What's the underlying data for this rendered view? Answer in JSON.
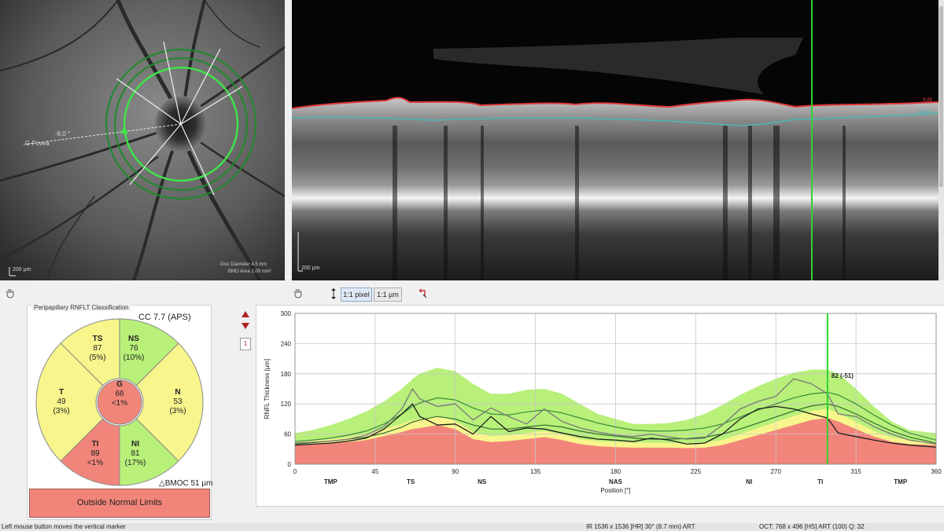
{
  "fundus": {
    "angle_label": "-8.0 °",
    "fovea_label": "G Fovea",
    "scale_label": "200 µm",
    "info_line1": "Disc Diameter 4.5 mm",
    "info_line2": "BMO Area 1.09 mm²"
  },
  "bscan": {
    "ilm_label": "ILM",
    "rnfl_label": "RNFL",
    "scale_label": "200 µm"
  },
  "toolbar": {
    "pixel_label": "1:1 pixel",
    "um_label": "1:1 µm"
  },
  "classification": {
    "title": "Peripapillary RNFLT Classification",
    "cc_label": "CC 7.7 (APS)",
    "bmo_label": "△BMOC 51 µm",
    "verdict": "Outside Normal Limits",
    "colors": {
      "normal": "#b8f07a",
      "borderline": "#f8f58c",
      "outside": "#f2857a"
    },
    "sectors": {
      "TS": {
        "name": "TS",
        "value": "87",
        "pct": "(5%)"
      },
      "NS": {
        "name": "NS",
        "value": "76",
        "pct": "(10%)"
      },
      "T": {
        "name": "T",
        "value": "49",
        "pct": "(3%)"
      },
      "N": {
        "name": "N",
        "value": "53",
        "pct": "(3%)"
      },
      "TI": {
        "name": "TI",
        "value": "89",
        "pct": "<1%"
      },
      "NI": {
        "name": "NI",
        "value": "81",
        "pct": "(17%)"
      },
      "G": {
        "name": "G",
        "value": "66",
        "pct": "<1%"
      }
    }
  },
  "side_controls": {
    "page_number": "1"
  },
  "chart_data": {
    "type": "line",
    "ylabel": "RNFL Thickness [µm]",
    "xlabel": "Position [°]",
    "xlim": [
      0,
      360
    ],
    "ylim": [
      0,
      300
    ],
    "x_ticks": [
      0,
      45,
      90,
      135,
      180,
      225,
      270,
      315,
      360
    ],
    "y_ticks": [
      0,
      60,
      120,
      180,
      240,
      300
    ],
    "sector_labels": [
      {
        "x": 20,
        "label": "TMP"
      },
      {
        "x": 65,
        "label": "TS"
      },
      {
        "x": 105,
        "label": "NS"
      },
      {
        "x": 180,
        "label": "NAS"
      },
      {
        "x": 255,
        "label": "NI"
      },
      {
        "x": 295,
        "label": "TI"
      },
      {
        "x": 340,
        "label": "TMP"
      }
    ],
    "marker_x": 299,
    "marker_label": "82 (-51)",
    "x": [
      0,
      10,
      20,
      30,
      40,
      50,
      60,
      66,
      70,
      80,
      90,
      100,
      110,
      120,
      130,
      140,
      150,
      160,
      170,
      180,
      190,
      200,
      210,
      220,
      230,
      240,
      250,
      260,
      270,
      280,
      290,
      299,
      305,
      315,
      325,
      335,
      345,
      360
    ],
    "bands": {
      "outside_upper": [
        38,
        40,
        42,
        44,
        48,
        56,
        64,
        70,
        72,
        78,
        70,
        50,
        44,
        46,
        50,
        54,
        48,
        40,
        36,
        34,
        33,
        33,
        33,
        32,
        33,
        38,
        48,
        58,
        68,
        78,
        88,
        92,
        85,
        70,
        55,
        45,
        40,
        38
      ],
      "borderline_upper": [
        45,
        47,
        50,
        54,
        60,
        70,
        80,
        88,
        90,
        96,
        86,
        64,
        56,
        58,
        62,
        66,
        60,
        50,
        46,
        44,
        43,
        43,
        42,
        42,
        43,
        48,
        60,
        72,
        84,
        96,
        106,
        110,
        102,
        84,
        66,
        54,
        48,
        45
      ],
      "normal_upper": [
        62,
        68,
        78,
        90,
        105,
        125,
        150,
        170,
        180,
        192,
        185,
        160,
        140,
        140,
        148,
        150,
        140,
        120,
        100,
        90,
        80,
        80,
        82,
        88,
        100,
        118,
        138,
        155,
        170,
        182,
        188,
        188,
        180,
        150,
        115,
        85,
        68,
        62
      ]
    },
    "series": [
      {
        "name": "",
        "color": "#3c8a3c",
        "values": [
          45,
          48,
          52,
          58,
          66,
          80,
          100,
          115,
          122,
          132,
          128,
          112,
          100,
          98,
          104,
          108,
          102,
          92,
          82,
          74,
          68,
          66,
          66,
          68,
          72,
          80,
          94,
          108,
          120,
          132,
          140,
          143,
          138,
          120,
          98,
          78,
          62,
          48
        ]
      },
      {
        "name": "",
        "color": "#2e6e2e",
        "values": [
          40,
          43,
          46,
          50,
          54,
          62,
          74,
          84,
          88,
          95,
          90,
          78,
          70,
          70,
          74,
          78,
          74,
          66,
          60,
          56,
          52,
          50,
          50,
          51,
          54,
          60,
          70,
          82,
          94,
          106,
          116,
          120,
          115,
          100,
          82,
          66,
          54,
          42
        ]
      },
      {
        "name": "",
        "color": "#777777",
        "values": [
          42,
          44,
          46,
          50,
          58,
          75,
          110,
          150,
          130,
          115,
          120,
          88,
          112,
          95,
          80,
          110,
          85,
          72,
          64,
          58,
          55,
          60,
          54,
          50,
          52,
          78,
          110,
          125,
          135,
          170,
          160,
          140,
          100,
          95,
          75,
          60,
          48,
          40
        ]
      },
      {
        "name": "",
        "color": "#1e1e1e",
        "values": [
          38,
          40,
          42,
          46,
          52,
          70,
          100,
          120,
          95,
          78,
          80,
          60,
          95,
          65,
          72,
          70,
          62,
          55,
          50,
          48,
          45,
          52,
          48,
          40,
          42,
          60,
          90,
          110,
          115,
          110,
          100,
          92,
          62,
          55,
          48,
          42,
          38,
          34
        ]
      }
    ]
  },
  "status": {
    "left": "Left mouse button moves the vertical marker",
    "mid": "IR 1536 x 1536 [HR] 30° (8.7 mm) ART",
    "right": "OCT: 768 x 496 [HS] ART (100) Q: 32"
  }
}
